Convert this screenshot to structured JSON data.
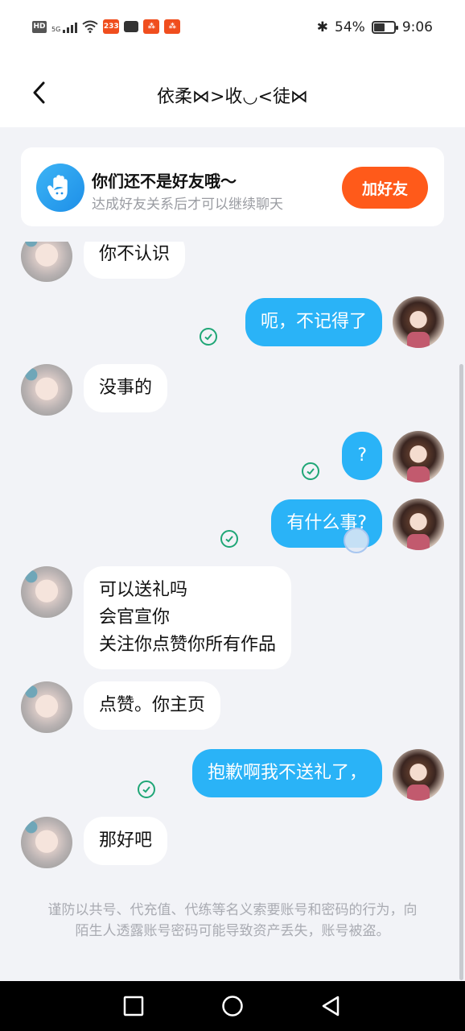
{
  "status_bar": {
    "hd": "HD",
    "network": "5G",
    "badge_233": "233",
    "battery": "54%",
    "battery_level": 0.54,
    "time": "9:06"
  },
  "header": {
    "title": "依柔⋈>收◡<徒⋈"
  },
  "friend_prompt": {
    "title": "你们还不是好友哦～",
    "subtitle": "达成好友关系后才可以继续聊天",
    "button": "加好友"
  },
  "messages": [
    {
      "side": "left",
      "text": "你不认识"
    },
    {
      "side": "right",
      "text": "呃，不记得了"
    },
    {
      "side": "left",
      "text": "没事的"
    },
    {
      "side": "right",
      "text": "?"
    },
    {
      "side": "right",
      "text": "有什么事?"
    },
    {
      "side": "left",
      "lines": [
        "可以送礼吗",
        "会官宣你",
        "关注你点赞你所有作品"
      ]
    },
    {
      "side": "left",
      "text": "点赞。你主页"
    },
    {
      "side": "right",
      "text": "抱歉啊我不送礼了，"
    },
    {
      "side": "left",
      "text": "那好吧"
    }
  ],
  "warning": "谨防以共号、代充值、代练等名义索要账号和密码的行为，向陌生人透露账号密码可能导致资产丢失，账号被盗。",
  "icons": {
    "back": "chevron-left-icon",
    "hand": "waving-hand-icon",
    "check": "read-check-icon",
    "nav": [
      "recent-apps-icon",
      "home-icon",
      "back-triangle-icon"
    ]
  },
  "colors": {
    "accent_blue": "#2ab3f7",
    "add_button": "#ff5a1a",
    "check_green": "#1fa676",
    "background": "#f2f3f7"
  }
}
